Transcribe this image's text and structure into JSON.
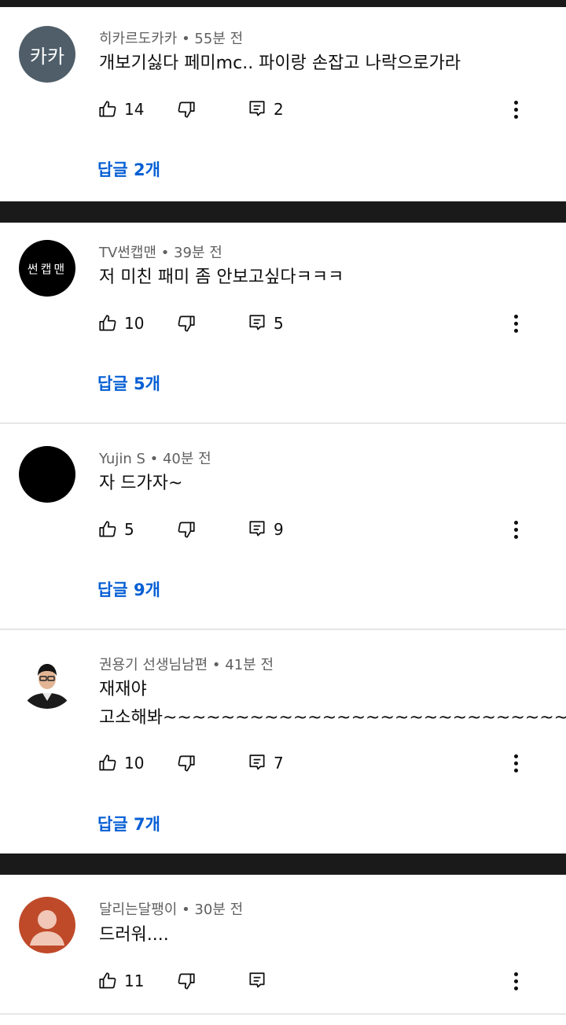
{
  "colors": {
    "accent": "#065fd4",
    "meta": "#606060",
    "text": "#0f0f0f",
    "divider": "#1a1a1a"
  },
  "comments": [
    {
      "author": "히카르도카카",
      "time": "55분 전",
      "meta": "히카르도카카 • 55분 전",
      "avatar_text": "카카",
      "avatar_color": "#4f5e69",
      "lines": [
        "개보기싫다 페미mc.. 파이랑 손잡고 나락으로가라"
      ],
      "likes": "14",
      "reply_count": "2",
      "replies_label": "답글 2개"
    },
    {
      "author": "TV썬캡맨",
      "time": "39분 전",
      "meta": "TV썬캡맨 • 39분 전",
      "avatar_text": "썬캡맨",
      "avatar_color": "#000000",
      "lines": [
        "저 미친 패미 좀 안보고싶다ㅋㅋㅋ"
      ],
      "likes": "10",
      "reply_count": "5",
      "replies_label": "답글 5개"
    },
    {
      "author": "Yujin S",
      "time": "40분 전",
      "meta": "Yujin S • 40분 전",
      "avatar_text": "",
      "avatar_color": "#000000",
      "lines": [
        "자 드가자~"
      ],
      "likes": "5",
      "reply_count": "9",
      "replies_label": "답글 9개"
    },
    {
      "author": "권용기 선생님남편",
      "time": "41분 전",
      "meta": "권용기 선생님남편 • 41분 전",
      "avatar_text": "",
      "avatar_color": "#ffffff",
      "lines": [
        "재재야",
        "고소해봐~~~~~~~~~~~~~~~~~~~~~~~~~~~~"
      ],
      "likes": "10",
      "reply_count": "7",
      "replies_label": "답글 7개"
    },
    {
      "author": "달리는달팽이",
      "time": "30분 전",
      "meta": "달리는달팽이 • 30분 전",
      "avatar_text": "",
      "avatar_color": "#bf4a2a",
      "lines": [
        "드러워...."
      ],
      "likes": "11",
      "reply_count": "",
      "replies_label": ""
    }
  ]
}
